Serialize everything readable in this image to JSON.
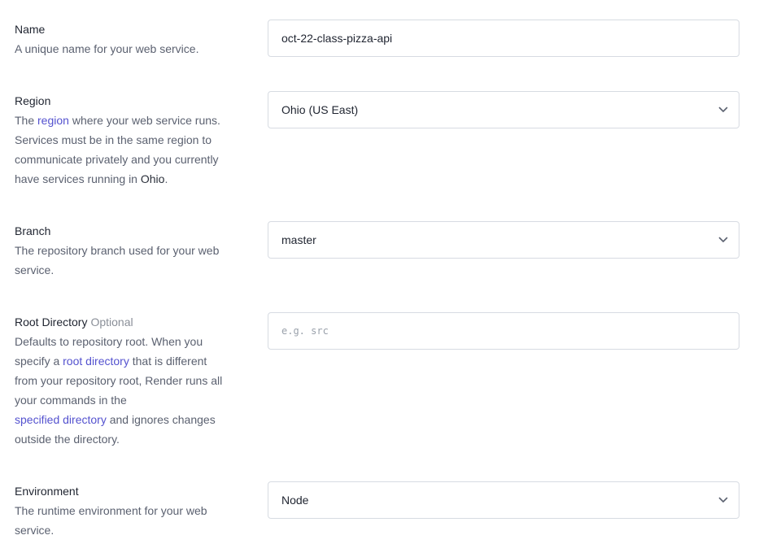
{
  "name": {
    "title": "Name",
    "desc": "A unique name for your web service.",
    "value": "oct-22-class-pizza-api"
  },
  "region": {
    "title": "Region",
    "desc_1": "The ",
    "link": "region",
    "desc_2": " where your web service runs.",
    "desc_3": "Services must be in the same region to",
    "desc_4": "communicate privately and you currently",
    "desc_5": "have services running in ",
    "strong": "Ohio",
    "desc_6": ".",
    "selected": "Ohio (US East)",
    "icon": "chevron-down-icon"
  },
  "branch": {
    "title": "Branch",
    "desc_1": "The repository branch used for your web",
    "desc_2": "service.",
    "selected": "master",
    "icon": "chevron-down-icon"
  },
  "root_directory": {
    "title": "Root Directory",
    "optional": "Optional",
    "desc_1": "Defaults to repository root. When you",
    "desc_2a": "specify a ",
    "link_1": "root directory",
    "desc_2b": " that is different",
    "desc_3": "from your repository root, Render runs all",
    "desc_4": "your commands in the",
    "link_2": "specified directory",
    "desc_5": " and ignores changes",
    "desc_6": "outside the directory.",
    "value": "",
    "placeholder": "e.g. src"
  },
  "environment": {
    "title": "Environment",
    "desc_1": "The runtime environment for your web",
    "desc_2": "service.",
    "selected": "Node",
    "icon": "chevron-down-icon"
  },
  "colors": {
    "link": "#5452cf",
    "border": "#d7dbe2",
    "text": "#1f2430",
    "muted": "#5b6170"
  }
}
